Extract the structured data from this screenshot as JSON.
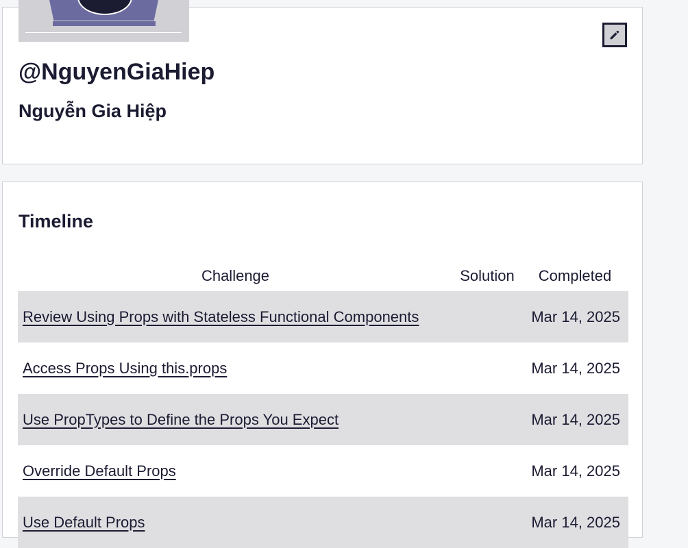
{
  "profile": {
    "username": "@NguyenGiaHiep",
    "full_name": "Nguyễn Gia Hiệp",
    "edit_icon": "pencil-icon"
  },
  "timeline": {
    "title": "Timeline",
    "columns": [
      "Challenge",
      "Solution",
      "Completed"
    ],
    "rows": [
      {
        "challenge": "Review Using Props with Stateless Functional Components",
        "solution": "",
        "completed": "Mar 14, 2025"
      },
      {
        "challenge": "Access Props Using this.props",
        "solution": "",
        "completed": "Mar 14, 2025"
      },
      {
        "challenge": "Use PropTypes to Define the Props You Expect",
        "solution": "",
        "completed": "Mar 14, 2025"
      },
      {
        "challenge": "Override Default Props",
        "solution": "",
        "completed": "Mar 14, 2025"
      },
      {
        "challenge": "Use Default Props",
        "solution": "",
        "completed": "Mar 14, 2025"
      }
    ]
  },
  "colors": {
    "text": "#1b1b32",
    "row_alt": "#dfdfe2",
    "page_bg": "#f5f6f7",
    "avatar_accent": "#6c6ba0"
  }
}
